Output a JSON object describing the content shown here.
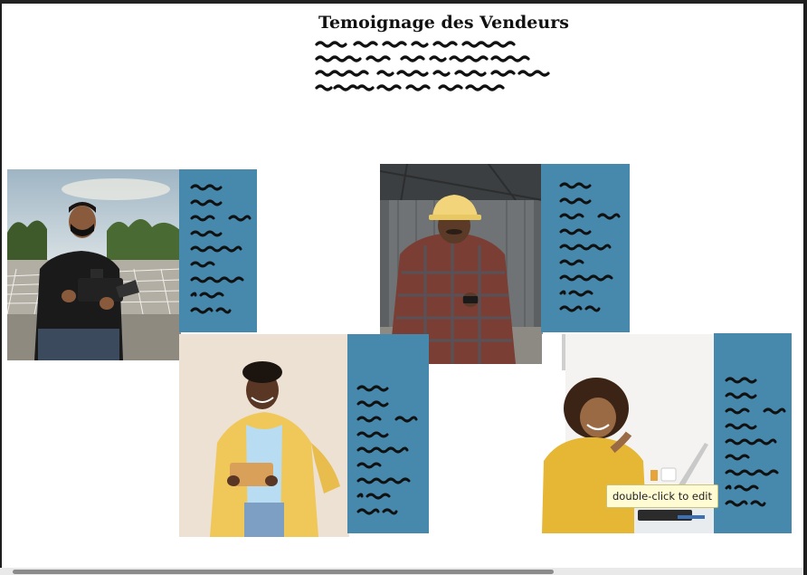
{
  "page": {
    "title": "Temoignage des Vendeurs",
    "intro_lines": 4
  },
  "testimonials": [
    {
      "name": "photo-man-camera",
      "card_color": "#4689ad"
    },
    {
      "name": "photo-man-hardhat",
      "card_color": "#4689ad"
    },
    {
      "name": "photo-woman-tablet",
      "card_color": "#4689ad"
    },
    {
      "name": "photo-woman-laptop",
      "card_color": "#4689ad"
    }
  ],
  "tooltip": {
    "text": "double-click to edit"
  }
}
